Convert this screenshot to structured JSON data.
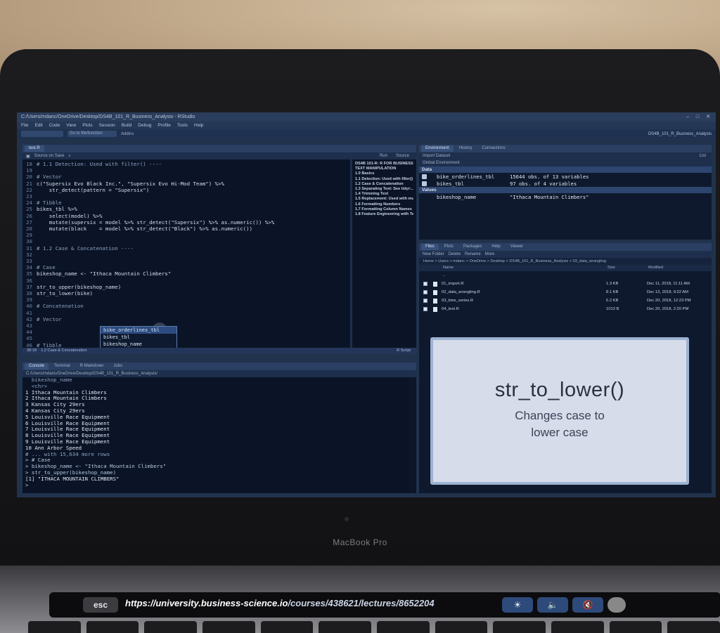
{
  "window": {
    "title": "C:/Users/mdanc/OneDrive/Desktop/DS4B_101_R_Business_Analysis - RStudio",
    "controls": [
      "–",
      "□",
      "✕"
    ],
    "menu": [
      "File",
      "Edit",
      "Code",
      "View",
      "Plots",
      "Session",
      "Build",
      "Debug",
      "Profile",
      "Tools",
      "Help"
    ],
    "goto_placeholder": "Go to file/function",
    "addins": "Addins",
    "project": "DS4B_101_R_Business_Analysis"
  },
  "editor": {
    "tab": "test.R",
    "source_on_save": "Source on Save",
    "run": "Run",
    "source": "Source",
    "lines": [
      {
        "n": "18",
        "t": "# 1.1 Detection: Used with filter() ----",
        "kind": "comment"
      },
      {
        "n": "19",
        "t": "",
        "kind": "code"
      },
      {
        "n": "20",
        "t": "# Vector",
        "kind": "comment"
      },
      {
        "n": "21",
        "t": "c(\"Supersix Evo Black Inc.\", \"Supersix Evo Hi-Mod Team\") %>%",
        "kind": "code"
      },
      {
        "n": "22",
        "t": "    str_detect(pattern = \"Supersix\")",
        "kind": "code"
      },
      {
        "n": "23",
        "t": "",
        "kind": "code"
      },
      {
        "n": "24",
        "t": "# Tibble",
        "kind": "comment"
      },
      {
        "n": "25",
        "t": "bikes_tbl %>%",
        "kind": "code"
      },
      {
        "n": "26",
        "t": "    select(model) %>%",
        "kind": "code"
      },
      {
        "n": "27",
        "t": "    mutate(supersix = model %>% str_detect(\"Supersix\") %>% as.numeric()) %>%",
        "kind": "code"
      },
      {
        "n": "28",
        "t": "    mutate(black    = model %>% str_detect(\"Black\") %>% as.numeric())",
        "kind": "code"
      },
      {
        "n": "29",
        "t": "",
        "kind": "code"
      },
      {
        "n": "30",
        "t": "",
        "kind": "code"
      },
      {
        "n": "31",
        "t": "# 1.2 Case & Concatenation ----",
        "kind": "comment"
      },
      {
        "n": "32",
        "t": "",
        "kind": "code"
      },
      {
        "n": "33",
        "t": "",
        "kind": "code"
      },
      {
        "n": "34",
        "t": "# Case",
        "kind": "comment"
      },
      {
        "n": "35",
        "t": "bikeshop_name <- \"Ithaca Mountain Climbers\"",
        "kind": "code"
      },
      {
        "n": "36",
        "t": "",
        "kind": "code"
      },
      {
        "n": "37",
        "t": "str_to_upper(bikeshop_name)",
        "kind": "code"
      },
      {
        "n": "38",
        "t": "str_to_lower(bike)",
        "kind": "code"
      },
      {
        "n": "39",
        "t": "",
        "kind": "code"
      },
      {
        "n": "40",
        "t": "# Concatenation",
        "kind": "comment"
      },
      {
        "n": "41",
        "t": "",
        "kind": "code"
      },
      {
        "n": "42",
        "t": "# Vector",
        "kind": "comment"
      },
      {
        "n": "43",
        "t": "",
        "kind": "code"
      },
      {
        "n": "44",
        "t": "",
        "kind": "code"
      },
      {
        "n": "45",
        "t": "",
        "kind": "code"
      },
      {
        "n": "46",
        "t": "# Tibble",
        "kind": "comment"
      },
      {
        "n": "47",
        "t": "",
        "kind": "code"
      }
    ],
    "autocomplete": [
      "bike_orderlines_tbl",
      "bikes_tbl",
      "bikeshop_name"
    ],
    "outline": [
      "DS4B 101-R: R FOR BUSINESS ...",
      "TEXT MANIPULATION",
      "1.0 Basics",
      "1.1 Detection: Used with filter()",
      "1.2 Case & Concatenation",
      "1.3 Separating Text: See tidyr:...",
      "1.4 Trimming Text",
      "1.5 Replacement: Used with mu...",
      "1.6 Formatting Numbers",
      "1.7 Formatting Column Names",
      "1.8 Feature Engineering with Text"
    ],
    "status_pos": "38:18",
    "status_section": "1.2 Case & Concatenation",
    "status_lang": "R Script"
  },
  "console": {
    "tabs": [
      "Console",
      "Terminal",
      "R Markdown",
      "Jobs"
    ],
    "path": "C:/Users/mdanc/OneDrive/Desktop/DS4B_101_R_Business_Analysis/",
    "lines": [
      {
        "t": "  bikeshop_name",
        "kind": "dim"
      },
      {
        "t": "  <chr>",
        "kind": "dim"
      },
      {
        "t": "1 Ithaca Mountain Climbers",
        "kind": "out"
      },
      {
        "t": "2 Ithaca Mountain Climbers",
        "kind": "out"
      },
      {
        "t": "3 Kansas City 29ers",
        "kind": "out"
      },
      {
        "t": "4 Kansas City 29ers",
        "kind": "out"
      },
      {
        "t": "5 Louisville Race Equipment",
        "kind": "out"
      },
      {
        "t": "6 Louisville Race Equipment",
        "kind": "out"
      },
      {
        "t": "7 Louisville Race Equipment",
        "kind": "out"
      },
      {
        "t": "8 Louisville Race Equipment",
        "kind": "out"
      },
      {
        "t": "9 Louisville Race Equipment",
        "kind": "out"
      },
      {
        "t": "10 Ann Arbor Speed",
        "kind": "out"
      },
      {
        "t": "# ... with 15,634 more rows",
        "kind": "dim"
      },
      {
        "t": "> # Case",
        "kind": "prompt"
      },
      {
        "t": "> bikeshop_name <- \"Ithaca Mountain Climbers\"",
        "kind": "prompt"
      },
      {
        "t": "> str_to_upper(bikeshop_name)",
        "kind": "prompt"
      },
      {
        "t": "[1] \"ITHACA MOUNTAIN CLIMBERS\"",
        "kind": "out"
      },
      {
        "t": ">",
        "kind": "prompt"
      }
    ]
  },
  "environment": {
    "tabs": [
      "Environment",
      "History",
      "Connections"
    ],
    "import": "Import Dataset",
    "scope": "Global Environment",
    "list_view": "List",
    "data_header": "Data",
    "data": [
      {
        "name": "bike_orderlines_tbl",
        "value": "15644 obs. of 13 variables"
      },
      {
        "name": "bikes_tbl",
        "value": "97 obs. of 4 variables"
      }
    ],
    "values_header": "Values",
    "values": [
      {
        "name": "bikeshop_name",
        "value": "\"Ithaca Mountain Climbers\""
      }
    ]
  },
  "files": {
    "tabs": [
      "Files",
      "Plots",
      "Packages",
      "Help",
      "Viewer"
    ],
    "toolbar": [
      "New Folder",
      "Delete",
      "Rename",
      "More"
    ],
    "path": "Home > Users > mdanc > OneDrive > Desktop > DS4B_101_R_Business_Analysis > 03_data_wrangling",
    "columns": [
      "Name",
      "Size",
      "Modified"
    ],
    "parent": "..",
    "rows": [
      {
        "name": "01_import.R",
        "size": "1.3 KB",
        "modified": "Dec 11, 2018, 11:11 AM"
      },
      {
        "name": "02_data_wrangling.R",
        "size": "8.1 KB",
        "modified": "Dec 13, 2018, 9:22 AM"
      },
      {
        "name": "03_time_series.R",
        "size": "5.2 KB",
        "modified": "Dec 20, 2018, 12:23 PM"
      },
      {
        "name": "04_text.R",
        "size": "1013 B",
        "modified": "Dec 20, 2018, 2:20 PM"
      }
    ]
  },
  "overlay": {
    "title": "str_to_lower()",
    "subtitle_line1": "Changes case to",
    "subtitle_line2": "lower case"
  },
  "device": {
    "brand": "MacBook Pro",
    "esc": "esc",
    "url_prefix": "https://university.business-science.io",
    "url_rest": "/courses/438621/lectures/8652204"
  },
  "colors": {
    "ide_bg": "#0a1426",
    "panel_header": "#2a3f62",
    "card_bg": "#d6dcea",
    "card_border": "#9eb2d2"
  }
}
